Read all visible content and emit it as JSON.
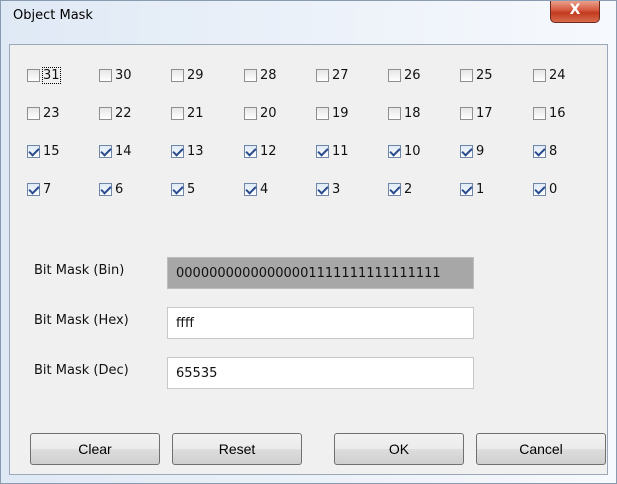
{
  "window": {
    "title": "Object Mask",
    "close_label": "X"
  },
  "bits": [
    {
      "label": "31",
      "checked": false
    },
    {
      "label": "30",
      "checked": false
    },
    {
      "label": "29",
      "checked": false
    },
    {
      "label": "28",
      "checked": false
    },
    {
      "label": "27",
      "checked": false
    },
    {
      "label": "26",
      "checked": false
    },
    {
      "label": "25",
      "checked": false
    },
    {
      "label": "24",
      "checked": false
    },
    {
      "label": "23",
      "checked": false
    },
    {
      "label": "22",
      "checked": false
    },
    {
      "label": "21",
      "checked": false
    },
    {
      "label": "20",
      "checked": false
    },
    {
      "label": "19",
      "checked": false
    },
    {
      "label": "18",
      "checked": false
    },
    {
      "label": "17",
      "checked": false
    },
    {
      "label": "16",
      "checked": false
    },
    {
      "label": "15",
      "checked": true
    },
    {
      "label": "14",
      "checked": true
    },
    {
      "label": "13",
      "checked": true
    },
    {
      "label": "12",
      "checked": true
    },
    {
      "label": "11",
      "checked": true
    },
    {
      "label": "10",
      "checked": true
    },
    {
      "label": "9",
      "checked": true
    },
    {
      "label": "8",
      "checked": true
    },
    {
      "label": "7",
      "checked": true
    },
    {
      "label": "6",
      "checked": true
    },
    {
      "label": "5",
      "checked": true
    },
    {
      "label": "4",
      "checked": true
    },
    {
      "label": "3",
      "checked": true
    },
    {
      "label": "2",
      "checked": true
    },
    {
      "label": "1",
      "checked": true
    },
    {
      "label": "0",
      "checked": true
    }
  ],
  "fields": {
    "bin_label": "Bit Mask (Bin)",
    "bin_value": "00000000000000001111111111111111",
    "hex_label": "Bit Mask (Hex)",
    "hex_value": "ffff",
    "dec_label": "Bit Mask (Dec)",
    "dec_value": "65535"
  },
  "buttons": {
    "clear": "Clear",
    "reset": "Reset",
    "ok": "OK",
    "cancel": "Cancel"
  }
}
